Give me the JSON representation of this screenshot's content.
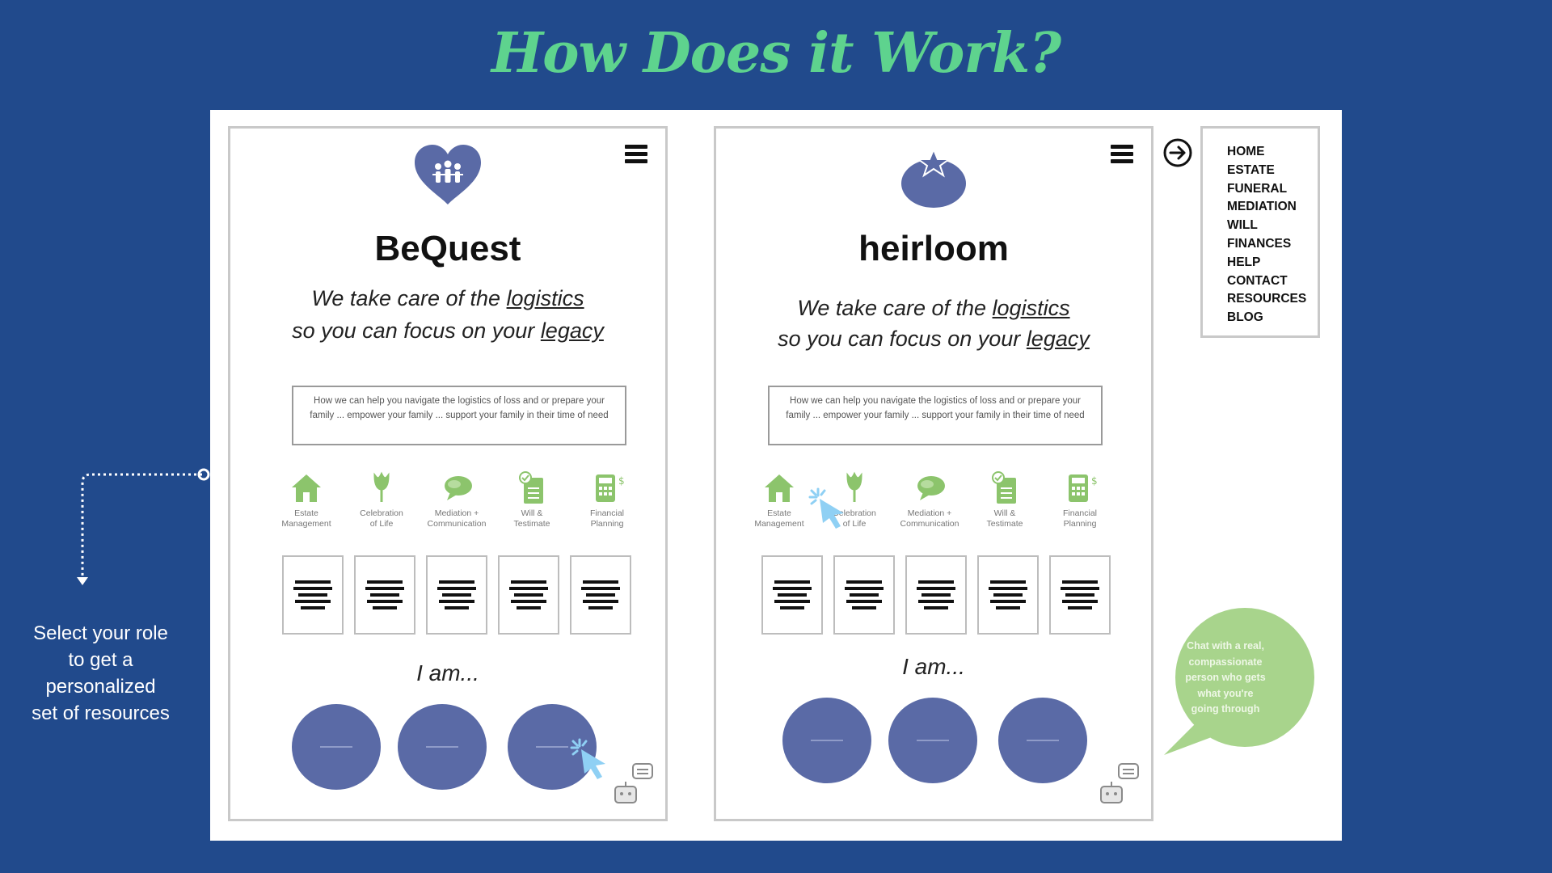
{
  "slide": {
    "title": "How Does it Work?",
    "side_note": [
      "Select your role",
      "to get a",
      "personalized",
      "set of resources"
    ]
  },
  "colors": {
    "background": "#214a8c",
    "title": "#5ed38e",
    "brand_blue": "#5a6aa6",
    "category_green": "#8cc46c",
    "chat_bubble": "#a8d48c",
    "cursor": "#8fd0f4"
  },
  "phone_left": {
    "brand": "BeQuest",
    "logo_icon": "heart-family-icon",
    "tagline_line1_pre": "We take care of the ",
    "tagline_line1_link": "logistics",
    "tagline_line2_pre": "so you can focus on your ",
    "tagline_line2_link": "legacy",
    "description": "How we can help you navigate the logistics of loss and or prepare your family ... empower your family ... support your family in their time of need",
    "iam": "I am...",
    "categories": [
      {
        "label": "Estate\nManagement",
        "icon": "house-icon"
      },
      {
        "label": "Celebration\nof Life",
        "icon": "flower-icon"
      },
      {
        "label": "Mediation +\nCommunication",
        "icon": "chat-bubbles-icon"
      },
      {
        "label": "Will &\nTestimate",
        "icon": "document-check-icon"
      },
      {
        "label": "Financial\nPlanning",
        "icon": "calculator-icon"
      }
    ]
  },
  "phone_right": {
    "brand": "heirloom",
    "logo_icon": "tomato-icon",
    "tagline_line1_pre": "We take care of the ",
    "tagline_line1_link": "logistics",
    "tagline_line2_pre": "so you can focus on your ",
    "tagline_line2_link": "legacy",
    "description": "How we can help you navigate the logistics of loss and or prepare your family ... empower your family ... support your family in their time of need",
    "iam": "I am...",
    "categories": [
      {
        "label": "Estate\nManagement",
        "icon": "house-icon"
      },
      {
        "label": "Celebration\nof Life",
        "icon": "flower-icon"
      },
      {
        "label": "Mediation +\nCommunication",
        "icon": "chat-bubbles-icon"
      },
      {
        "label": "Will &\nTestimate",
        "icon": "document-check-icon"
      },
      {
        "label": "Financial\nPlanning",
        "icon": "calculator-icon"
      }
    ]
  },
  "menu": {
    "items": [
      "HOME",
      "ESTATE",
      "FUNERAL",
      "MEDIATION",
      "WILL",
      "FINANCES",
      "HELP",
      "CONTACT",
      "RESOURCES",
      "BLOG"
    ]
  },
  "chat_bubble": {
    "text": [
      "Chat with a real,",
      "compassionate",
      "person who gets",
      "what you're",
      "going through"
    ]
  }
}
